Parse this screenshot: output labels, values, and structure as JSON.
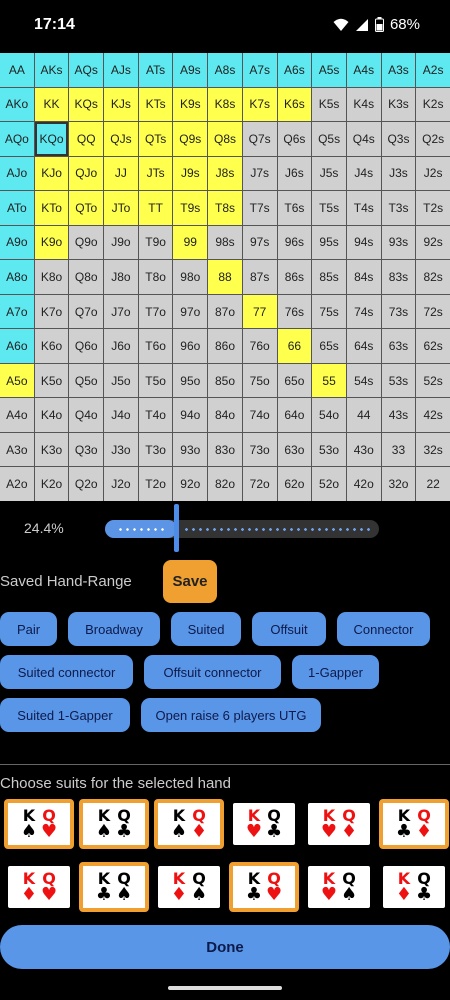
{
  "status_bar": {
    "time": "17:14",
    "battery": "68%"
  },
  "range_grid": {
    "rows": [
      [
        [
          "AA",
          "cyan"
        ],
        [
          "AKs",
          "cyan"
        ],
        [
          "AQs",
          "cyan"
        ],
        [
          "AJs",
          "cyan"
        ],
        [
          "ATs",
          "cyan"
        ],
        [
          "A9s",
          "cyan"
        ],
        [
          "A8s",
          "cyan"
        ],
        [
          "A7s",
          "cyan"
        ],
        [
          "A6s",
          "cyan"
        ],
        [
          "A5s",
          "cyan"
        ],
        [
          "A4s",
          "cyan"
        ],
        [
          "A3s",
          "cyan"
        ],
        [
          "A2s",
          "cyan"
        ]
      ],
      [
        [
          "AKo",
          "cyan"
        ],
        [
          "KK",
          "yellow"
        ],
        [
          "KQs",
          "yellow"
        ],
        [
          "KJs",
          "yellow"
        ],
        [
          "KTs",
          "yellow"
        ],
        [
          "K9s",
          "yellow"
        ],
        [
          "K8s",
          "yellow"
        ],
        [
          "K7s",
          "yellow"
        ],
        [
          "K6s",
          "yellow"
        ],
        [
          "K5s",
          "gray"
        ],
        [
          "K4s",
          "gray"
        ],
        [
          "K3s",
          "gray"
        ],
        [
          "K2s",
          "gray"
        ]
      ],
      [
        [
          "AQo",
          "cyan"
        ],
        [
          "KQo",
          "cyan"
        ],
        [
          "QQ",
          "yellow"
        ],
        [
          "QJs",
          "yellow"
        ],
        [
          "QTs",
          "yellow"
        ],
        [
          "Q9s",
          "yellow"
        ],
        [
          "Q8s",
          "yellow"
        ],
        [
          "Q7s",
          "gray"
        ],
        [
          "Q6s",
          "gray"
        ],
        [
          "Q5s",
          "gray"
        ],
        [
          "Q4s",
          "gray"
        ],
        [
          "Q3s",
          "gray"
        ],
        [
          "Q2s",
          "gray"
        ]
      ],
      [
        [
          "AJo",
          "cyan"
        ],
        [
          "KJo",
          "yellow"
        ],
        [
          "QJo",
          "yellow"
        ],
        [
          "JJ",
          "yellow"
        ],
        [
          "JTs",
          "yellow"
        ],
        [
          "J9s",
          "yellow"
        ],
        [
          "J8s",
          "yellow"
        ],
        [
          "J7s",
          "gray"
        ],
        [
          "J6s",
          "gray"
        ],
        [
          "J5s",
          "gray"
        ],
        [
          "J4s",
          "gray"
        ],
        [
          "J3s",
          "gray"
        ],
        [
          "J2s",
          "gray"
        ]
      ],
      [
        [
          "ATo",
          "cyan"
        ],
        [
          "KTo",
          "yellow"
        ],
        [
          "QTo",
          "yellow"
        ],
        [
          "JTo",
          "yellow"
        ],
        [
          "TT",
          "yellow"
        ],
        [
          "T9s",
          "yellow"
        ],
        [
          "T8s",
          "yellow"
        ],
        [
          "T7s",
          "gray"
        ],
        [
          "T6s",
          "gray"
        ],
        [
          "T5s",
          "gray"
        ],
        [
          "T4s",
          "gray"
        ],
        [
          "T3s",
          "gray"
        ],
        [
          "T2s",
          "gray"
        ]
      ],
      [
        [
          "A9o",
          "cyan"
        ],
        [
          "K9o",
          "yellow"
        ],
        [
          "Q9o",
          "gray"
        ],
        [
          "J9o",
          "gray"
        ],
        [
          "T9o",
          "gray"
        ],
        [
          "99",
          "yellow"
        ],
        [
          "98s",
          "gray"
        ],
        [
          "97s",
          "gray"
        ],
        [
          "96s",
          "gray"
        ],
        [
          "95s",
          "gray"
        ],
        [
          "94s",
          "gray"
        ],
        [
          "93s",
          "gray"
        ],
        [
          "92s",
          "gray"
        ]
      ],
      [
        [
          "A8o",
          "cyan"
        ],
        [
          "K8o",
          "gray"
        ],
        [
          "Q8o",
          "gray"
        ],
        [
          "J8o",
          "gray"
        ],
        [
          "T8o",
          "gray"
        ],
        [
          "98o",
          "gray"
        ],
        [
          "88",
          "yellow"
        ],
        [
          "87s",
          "gray"
        ],
        [
          "86s",
          "gray"
        ],
        [
          "85s",
          "gray"
        ],
        [
          "84s",
          "gray"
        ],
        [
          "83s",
          "gray"
        ],
        [
          "82s",
          "gray"
        ]
      ],
      [
        [
          "A7o",
          "cyan"
        ],
        [
          "K7o",
          "gray"
        ],
        [
          "Q7o",
          "gray"
        ],
        [
          "J7o",
          "gray"
        ],
        [
          "T7o",
          "gray"
        ],
        [
          "97o",
          "gray"
        ],
        [
          "87o",
          "gray"
        ],
        [
          "77",
          "yellow"
        ],
        [
          "76s",
          "gray"
        ],
        [
          "75s",
          "gray"
        ],
        [
          "74s",
          "gray"
        ],
        [
          "73s",
          "gray"
        ],
        [
          "72s",
          "gray"
        ]
      ],
      [
        [
          "A6o",
          "cyan"
        ],
        [
          "K6o",
          "gray"
        ],
        [
          "Q6o",
          "gray"
        ],
        [
          "J6o",
          "gray"
        ],
        [
          "T6o",
          "gray"
        ],
        [
          "96o",
          "gray"
        ],
        [
          "86o",
          "gray"
        ],
        [
          "76o",
          "gray"
        ],
        [
          "66",
          "yellow"
        ],
        [
          "65s",
          "gray"
        ],
        [
          "64s",
          "gray"
        ],
        [
          "63s",
          "gray"
        ],
        [
          "62s",
          "gray"
        ]
      ],
      [
        [
          "A5o",
          "yellow"
        ],
        [
          "K5o",
          "gray"
        ],
        [
          "Q5o",
          "gray"
        ],
        [
          "J5o",
          "gray"
        ],
        [
          "T5o",
          "gray"
        ],
        [
          "95o",
          "gray"
        ],
        [
          "85o",
          "gray"
        ],
        [
          "75o",
          "gray"
        ],
        [
          "65o",
          "gray"
        ],
        [
          "55",
          "yellow"
        ],
        [
          "54s",
          "gray"
        ],
        [
          "53s",
          "gray"
        ],
        [
          "52s",
          "gray"
        ]
      ],
      [
        [
          "A4o",
          "gray"
        ],
        [
          "K4o",
          "gray"
        ],
        [
          "Q4o",
          "gray"
        ],
        [
          "J4o",
          "gray"
        ],
        [
          "T4o",
          "gray"
        ],
        [
          "94o",
          "gray"
        ],
        [
          "84o",
          "gray"
        ],
        [
          "74o",
          "gray"
        ],
        [
          "64o",
          "gray"
        ],
        [
          "54o",
          "gray"
        ],
        [
          "44",
          "gray"
        ],
        [
          "43s",
          "gray"
        ],
        [
          "42s",
          "gray"
        ]
      ],
      [
        [
          "A3o",
          "gray"
        ],
        [
          "K3o",
          "gray"
        ],
        [
          "Q3o",
          "gray"
        ],
        [
          "J3o",
          "gray"
        ],
        [
          "T3o",
          "gray"
        ],
        [
          "93o",
          "gray"
        ],
        [
          "83o",
          "gray"
        ],
        [
          "73o",
          "gray"
        ],
        [
          "63o",
          "gray"
        ],
        [
          "53o",
          "gray"
        ],
        [
          "43o",
          "gray"
        ],
        [
          "33",
          "gray"
        ],
        [
          "32s",
          "gray"
        ]
      ],
      [
        [
          "A2o",
          "gray"
        ],
        [
          "K2o",
          "gray"
        ],
        [
          "Q2o",
          "gray"
        ],
        [
          "J2o",
          "gray"
        ],
        [
          "T2o",
          "gray"
        ],
        [
          "92o",
          "gray"
        ],
        [
          "82o",
          "gray"
        ],
        [
          "72o",
          "gray"
        ],
        [
          "62o",
          "gray"
        ],
        [
          "52o",
          "gray"
        ],
        [
          "42o",
          "gray"
        ],
        [
          "32o",
          "gray"
        ],
        [
          "22",
          "gray"
        ]
      ]
    ],
    "selected_hand": "KQo",
    "colors": {
      "cyan": "#5ee8f0",
      "yellow": "#ffff4d",
      "gray": "#d0d0d0"
    }
  },
  "range_slider": {
    "percent_label": "24.4%",
    "value": 24.4
  },
  "saved_range": {
    "label": "Saved Hand-Range",
    "save_label": "Save"
  },
  "presets": {
    "pair": "Pair",
    "broadway": "Broadway",
    "suited": "Suited",
    "offsuit": "Offsuit",
    "connector": "Connector",
    "suited_connector": "Suited connector",
    "offsuit_connector": "Offsuit connector",
    "one_gapper": "1-Gapper",
    "suited_one_gapper": "Suited 1-Gapper",
    "open_raise": "Open raise 6 players UTG"
  },
  "suits_section": {
    "label": "Choose suits for the selected hand",
    "combos": [
      {
        "k": "♠",
        "k_color": "black",
        "q": "♥",
        "q_color": "red",
        "selected": true
      },
      {
        "k": "♠",
        "k_color": "black",
        "q": "♣",
        "q_color": "black",
        "selected": true
      },
      {
        "k": "♠",
        "k_color": "black",
        "q": "♦",
        "q_color": "red",
        "selected": true
      },
      {
        "k": "♥",
        "k_color": "red",
        "q": "♣",
        "q_color": "black",
        "selected": false
      },
      {
        "k": "♥",
        "k_color": "red",
        "q": "♦",
        "q_color": "red",
        "selected": false
      },
      {
        "k": "♣",
        "k_color": "black",
        "q": "♦",
        "q_color": "red",
        "selected": true
      },
      {
        "k": "♦",
        "k_color": "red",
        "q": "♥",
        "q_color": "red",
        "selected": false
      },
      {
        "k": "♣",
        "k_color": "black",
        "q": "♠",
        "q_color": "black",
        "selected": true
      },
      {
        "k": "♦",
        "k_color": "red",
        "q": "♠",
        "q_color": "black",
        "selected": false
      },
      {
        "k": "♣",
        "k_color": "black",
        "q": "♥",
        "q_color": "red",
        "selected": true
      },
      {
        "k": "♥",
        "k_color": "red",
        "q": "♠",
        "q_color": "black",
        "selected": false
      },
      {
        "k": "♦",
        "k_color": "red",
        "q": "♣",
        "q_color": "black",
        "selected": false
      }
    ],
    "rank_k": "K",
    "rank_q": "Q"
  },
  "done_label": "Done"
}
